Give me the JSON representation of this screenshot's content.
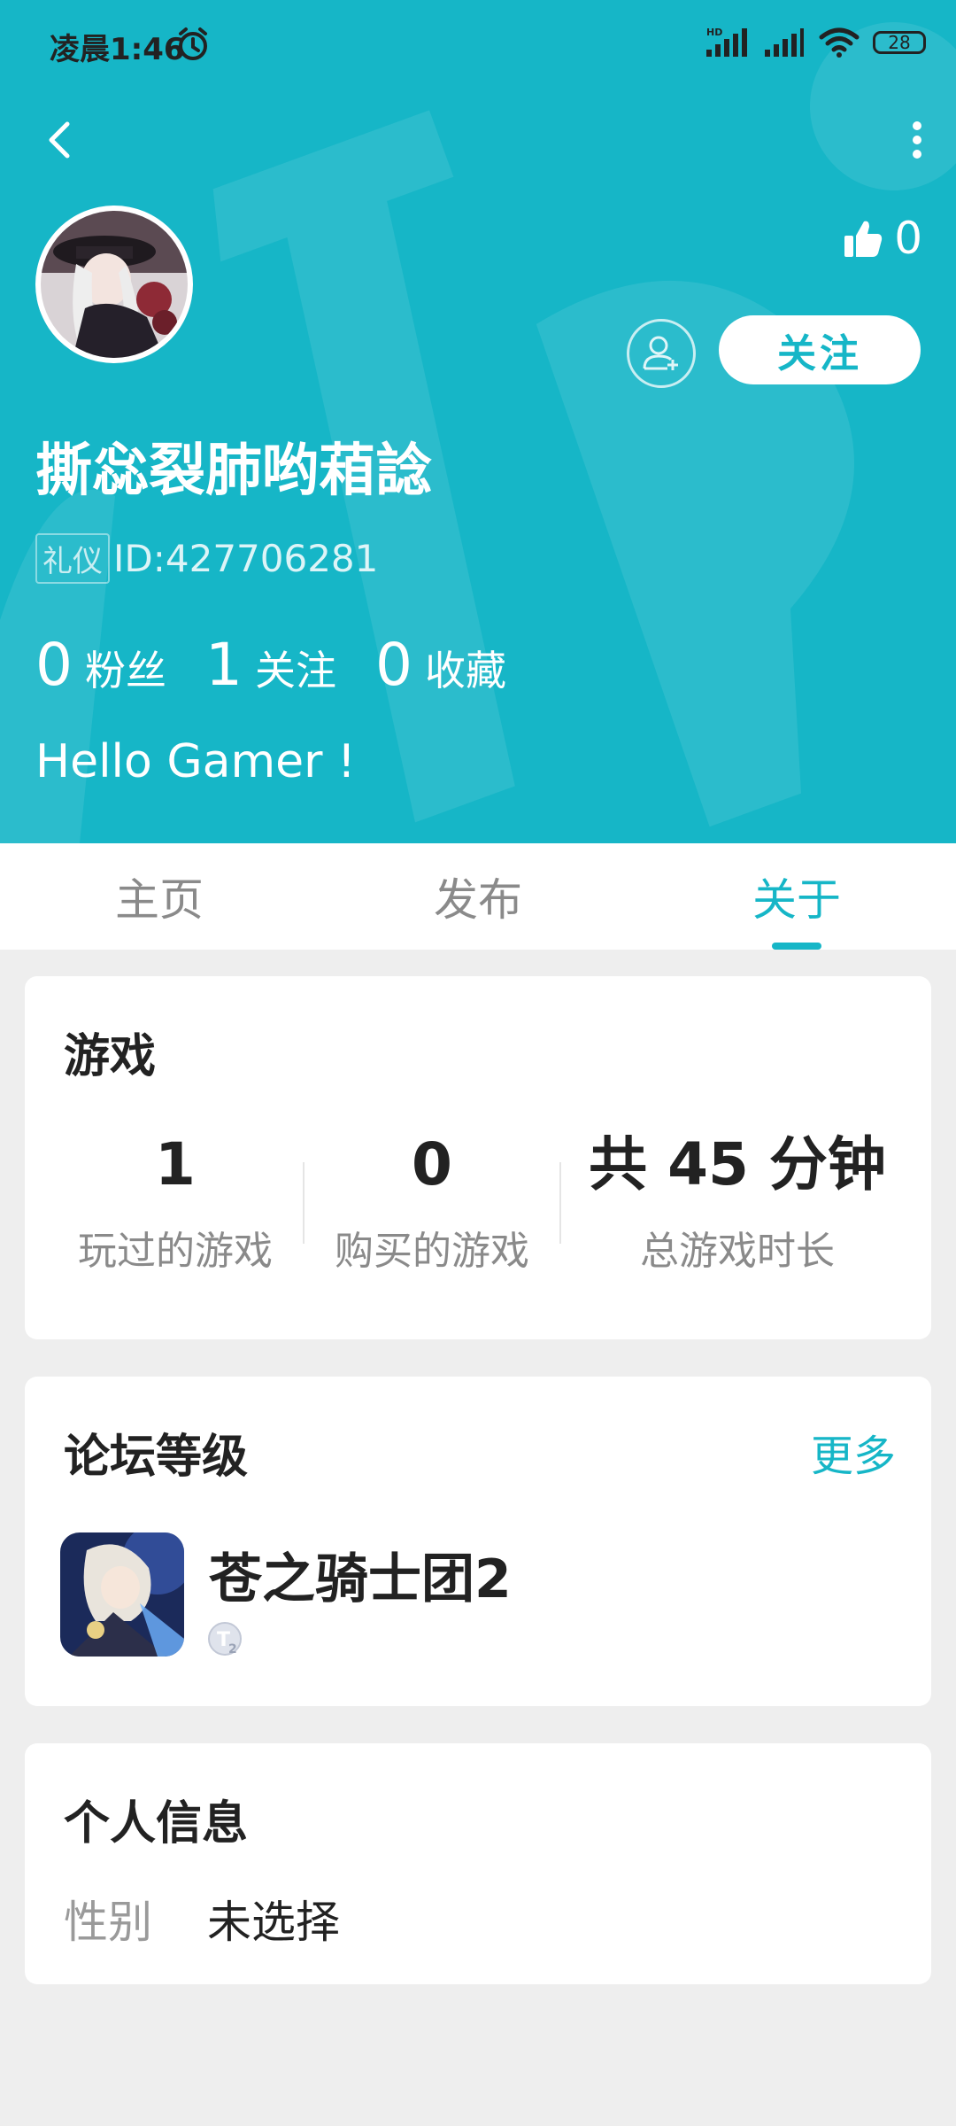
{
  "status_bar": {
    "time": "凌晨1:46",
    "battery": "28"
  },
  "profile": {
    "likes": "0",
    "follow_label": "关注",
    "username": "撕惢裂肺哟葙諗",
    "badge": "礼仪",
    "id": "ID:427706281",
    "stats": [
      {
        "num": "0",
        "label": "粉丝"
      },
      {
        "num": "1",
        "label": "关注"
      },
      {
        "num": "0",
        "label": "收藏"
      }
    ],
    "bio": "Hello Gamer !"
  },
  "tabs": [
    "主页",
    "发布",
    "关于"
  ],
  "active_tab": 2,
  "games": {
    "title": "游戏",
    "stats": [
      {
        "value": "1",
        "label": "玩过的游戏"
      },
      {
        "value": "0",
        "label": "购买的游戏"
      },
      {
        "value": "共 45 分钟",
        "label": "总游戏时长"
      }
    ]
  },
  "forum": {
    "title": "论坛等级",
    "more": "更多",
    "game_name": "苍之骑士团2"
  },
  "personal_info": {
    "title": "个人信息",
    "label": "性别",
    "value": "未选择"
  },
  "colors": {
    "accent": "#16b6c7",
    "background": "#eeeeee"
  }
}
